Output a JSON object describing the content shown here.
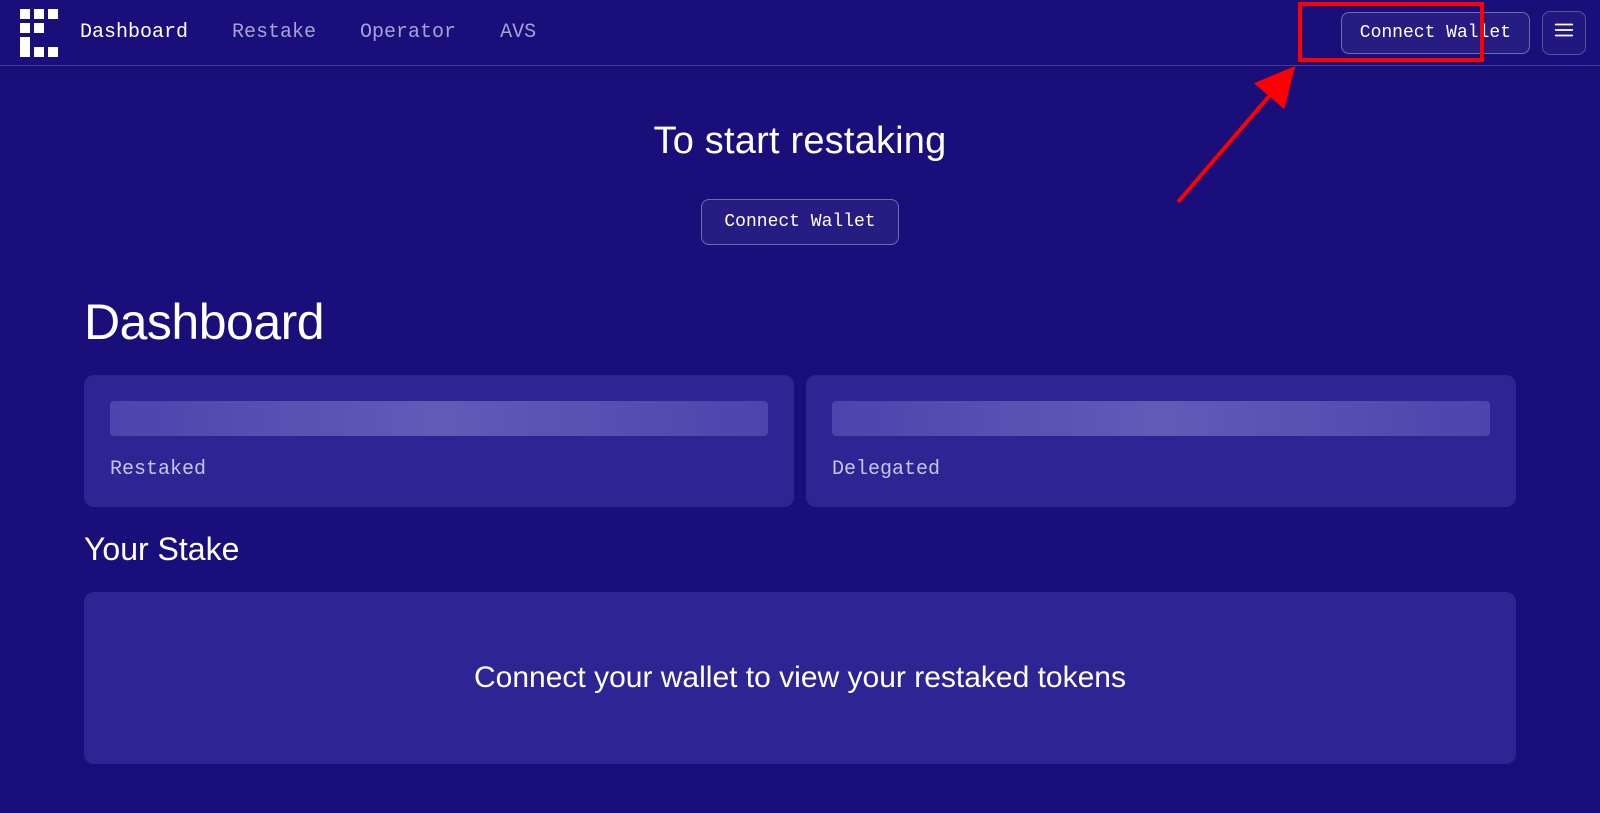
{
  "nav": {
    "items": [
      {
        "label": "Dashboard",
        "active": true
      },
      {
        "label": "Restake",
        "active": false
      },
      {
        "label": "Operator",
        "active": false
      },
      {
        "label": "AVS",
        "active": false
      }
    ],
    "connect_label": "Connect Wallet"
  },
  "hero": {
    "title": "To start restaking",
    "connect_label": "Connect Wallet"
  },
  "dashboard": {
    "title": "Dashboard",
    "cards": [
      {
        "label": "Restaked"
      },
      {
        "label": "Delegated"
      }
    ]
  },
  "stake": {
    "title": "Your Stake",
    "empty_message": "Connect your wallet to view your restaked tokens"
  },
  "annotation": {
    "highlight_target": "connect-wallet-button-top"
  }
}
